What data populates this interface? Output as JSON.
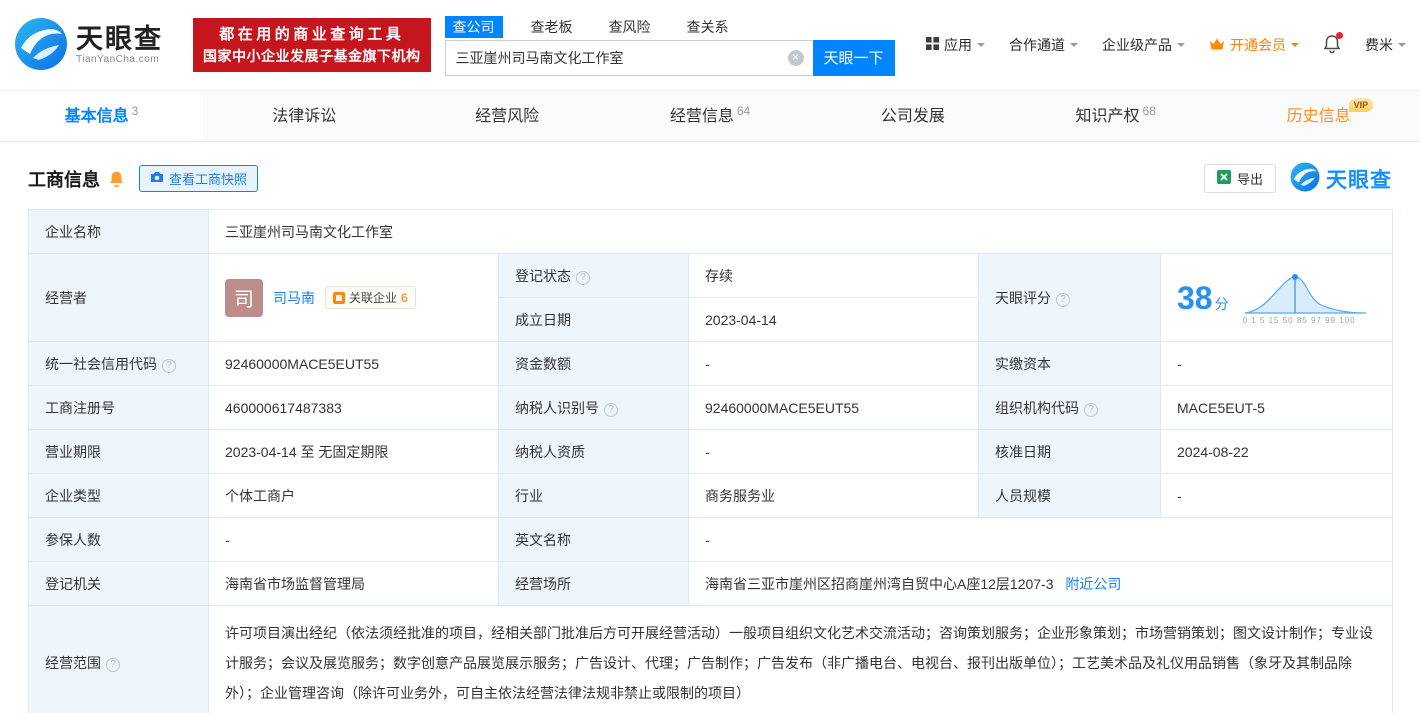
{
  "brand": {
    "name": "天眼查",
    "domain": "TianYanCha.com"
  },
  "promo": {
    "line1": "都在用的商业查询工具",
    "line2": "国家中小企业发展子基金旗下机构"
  },
  "search": {
    "tabs": [
      {
        "label": "查公司"
      },
      {
        "label": "查老板"
      },
      {
        "label": "查风险"
      },
      {
        "label": "查关系"
      }
    ],
    "value": "三亚崖州司马南文化工作室",
    "button": "天眼一下"
  },
  "top_nav": {
    "apps": "应用",
    "partner": "合作通道",
    "enterprise": "企业级产品",
    "vip": "开通会员",
    "user": "费米"
  },
  "page_tabs": [
    {
      "label": "基本信息",
      "count": "3"
    },
    {
      "label": "法律诉讼",
      "count": ""
    },
    {
      "label": "经营风险",
      "count": ""
    },
    {
      "label": "经营信息",
      "count": "64"
    },
    {
      "label": "公司发展",
      "count": ""
    },
    {
      "label": "知识产权",
      "count": "68"
    },
    {
      "label": "历史信息",
      "count": "",
      "badge": "VIP"
    }
  ],
  "section": {
    "title": "工商信息",
    "snapshot": "查看工商快照",
    "export": "导出",
    "brand": "天眼查"
  },
  "icons": {
    "help_glyph": "?",
    "clear_glyph": "×"
  },
  "table": {
    "company_name": {
      "label": "企业名称",
      "value": "三亚崖州司马南文化工作室"
    },
    "operator": {
      "label": "经营者",
      "avatar": "司",
      "name": "司马南",
      "related_label": "关联企业",
      "related_count": "6"
    },
    "reg_status": {
      "label": "登记状态",
      "value": "存续"
    },
    "establish_date": {
      "label": "成立日期",
      "value": "2023-04-14"
    },
    "score": {
      "label": "天眼评分",
      "value": "38",
      "unit": "分",
      "axis": "0 1 5 15 50 85 97 99 100"
    },
    "credit_code": {
      "label": "统一社会信用代码",
      "value": "92460000MACE5EUT55"
    },
    "capital": {
      "label": "资金数额",
      "value": "-"
    },
    "paid_capital": {
      "label": "实缴资本",
      "value": "-"
    },
    "reg_number": {
      "label": "工商注册号",
      "value": "460000617487383"
    },
    "taxpayer_id": {
      "label": "纳税人识别号",
      "value": "92460000MACE5EUT55"
    },
    "org_code": {
      "label": "组织机构代码",
      "value": "MACE5EUT-5"
    },
    "business_term": {
      "label": "营业期限",
      "value": "2023-04-14 至 无固定期限"
    },
    "taxpayer_quality": {
      "label": "纳税人资质",
      "value": "-"
    },
    "approval_date": {
      "label": "核准日期",
      "value": "2024-08-22"
    },
    "company_type": {
      "label": "企业类型",
      "value": "个体工商户"
    },
    "industry": {
      "label": "行业",
      "value": "商务服务业"
    },
    "staff_size": {
      "label": "人员规模",
      "value": "-"
    },
    "insured_count": {
      "label": "参保人数",
      "value": "-"
    },
    "english_name": {
      "label": "英文名称",
      "value": "-"
    },
    "reg_authority": {
      "label": "登记机关",
      "value": "海南省市场监督管理局"
    },
    "business_place": {
      "label": "经营场所",
      "value": "海南省三亚市崖州区招商崖州湾自贸中心A座12层1207-3",
      "link": "附近公司"
    },
    "business_scope": {
      "label": "经营范围",
      "value": "许可项目演出经纪（依法须经批准的项目，经相关部门批准后方可开展经营活动）一般项目组织文化艺术交流活动；咨询策划服务；企业形象策划；市场营销策划；图文设计制作；专业设计服务；会议及展览服务；数字创意产品展览展示服务；广告设计、代理；广告制作；广告发布（非广播电台、电视台、报刊出版单位）；工艺美术品及礼仪用品销售（象牙及其制品除外）；企业管理咨询（除许可业务外，可自主依法经营法律法规非禁止或限制的项目）"
    }
  }
}
